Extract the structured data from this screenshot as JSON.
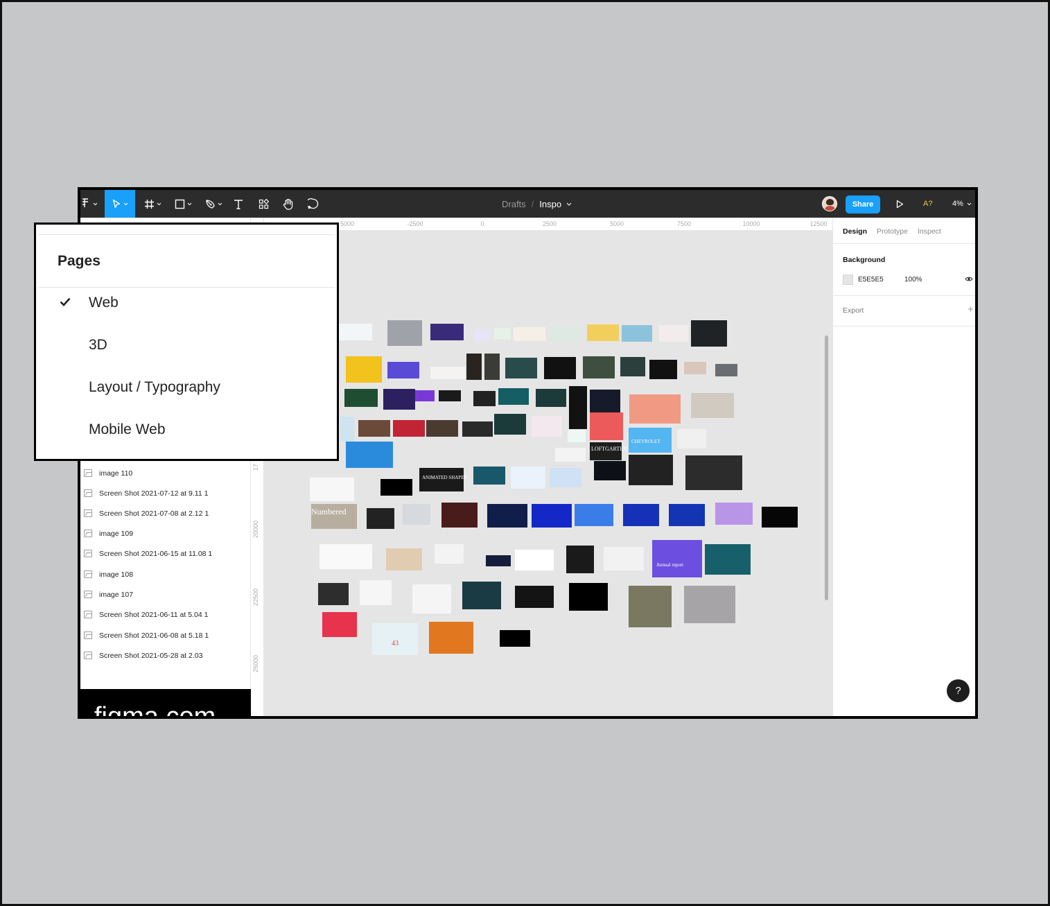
{
  "toolbar": {
    "breadcrumb_parent": "Drafts",
    "breadcrumb_separator": "/",
    "file_name": "Inspo",
    "share_label": "Share",
    "multiplayer_label": "A?",
    "zoom_level": "4%",
    "active_tool": "move",
    "tools": [
      "main-menu",
      "move",
      "frame",
      "shape",
      "pen",
      "text",
      "resources",
      "hand",
      "comment"
    ]
  },
  "rulers": {
    "horizontal": [
      "5000",
      "-2500",
      "0",
      "2500",
      "5000",
      "7500",
      "10000",
      "12500"
    ],
    "vertical": [
      "17",
      "20000",
      "22500",
      "25000"
    ]
  },
  "layers": [
    "image 110",
    "Screen Shot 2021-07-12 at 9.11 1",
    "Screen Shot 2021-07-08 at 2.12 1",
    "image 109",
    "Screen Shot 2021-06-15 at 11.08 1",
    "image 108",
    "image 107",
    "Screen Shot 2021-06-11 at 5.04 1",
    "Screen Shot 2021-06-08 at 5.18 1",
    "Screen Shot 2021-05-28 at 2.03"
  ],
  "brand_text": "figma.com",
  "pages_popup": {
    "title": "Pages",
    "pages": [
      "Web",
      "3D",
      "Layout / Typography",
      "Mobile Web"
    ],
    "selected_page": "Web"
  },
  "right_panel": {
    "tabs": [
      "Design",
      "Prototype",
      "Inspect"
    ],
    "active_tab": "Design",
    "background_label": "Background",
    "background_hex": "E5E5E5",
    "background_opacity": "100%",
    "export_label": "Export",
    "export_add": "+"
  },
  "canvas_thumbnail_texts": {
    "numbered": "Numbered",
    "animated_shapes": "ANIMATED SHAPES",
    "loftgarten": "LOFTGARTEN",
    "chevrolet": "CHEVROLET",
    "annual_report": "Annual report",
    "page_43": "43"
  },
  "help_label": "?",
  "colors": {
    "toolbar_bg": "#2c2c2c",
    "accent": "#18a0fb",
    "canvas_bg": "#E5E5E5",
    "multiplayer": "#f2c94c"
  }
}
